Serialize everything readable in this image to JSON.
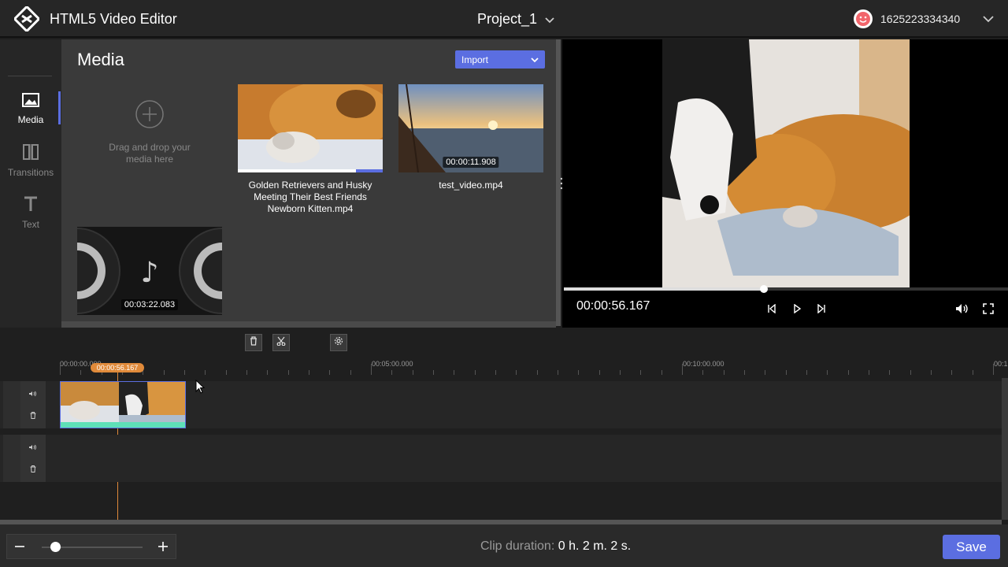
{
  "header": {
    "app_title": "HTML5 Video Editor",
    "project_name": "Project_1",
    "user_id": "1625223334340"
  },
  "sidebar": {
    "items": [
      {
        "label": "Media",
        "icon": "image-icon",
        "active": true
      },
      {
        "label": "Transitions",
        "icon": "transitions-icon",
        "active": false
      },
      {
        "label": "Text",
        "icon": "text-icon",
        "active": false
      }
    ]
  },
  "media": {
    "title": "Media",
    "import_label": "Import",
    "drop_text_1": "Drag and drop your",
    "drop_text_2": "media here",
    "files": [
      {
        "name_1": "Golden Retrievers and Husky",
        "name_2": "Meeting Their Best Friends",
        "name_3": "Newborn Kitten.mp4",
        "duration": ""
      },
      {
        "name_1": "test_video.mp4",
        "name_2": "",
        "name_3": "",
        "duration": "00:00:11.908"
      },
      {
        "name_1": "",
        "name_2": "",
        "name_3": "",
        "duration": "00:03:22.083"
      }
    ]
  },
  "preview": {
    "timecode": "00:00:56.167",
    "progress": 0.45
  },
  "timeline": {
    "ruler_labels": [
      "00:00:00.000",
      "00:05:00.000",
      "00:10:00.000",
      "00:1"
    ],
    "playhead_time": "00:00:56.167"
  },
  "footer": {
    "clip_duration_label": "Clip duration:",
    "clip_duration_value": "0 h. 2 m. 2 s.",
    "save_label": "Save",
    "zoom_level": 0.13
  },
  "colors": {
    "accent": "#5b6ee1",
    "playhead": "#e08a3a",
    "clip_bar": "#5ee0b8"
  }
}
